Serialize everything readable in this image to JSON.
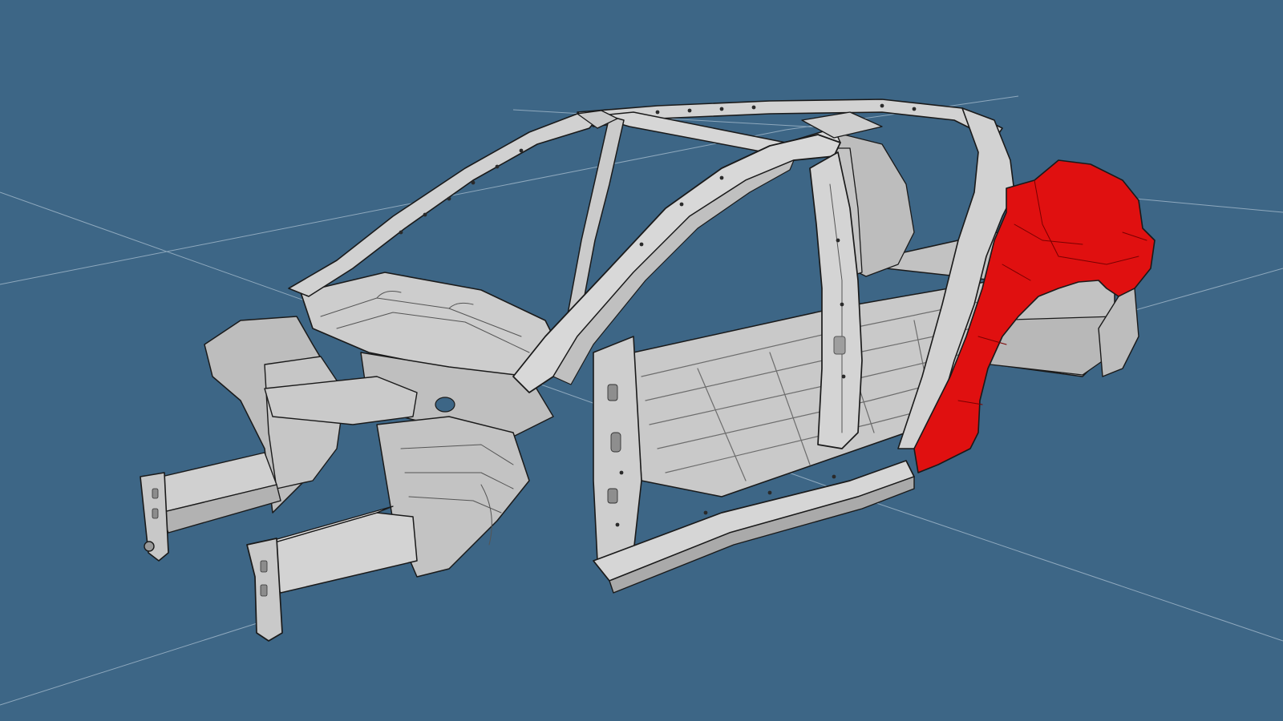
{
  "viewport": {
    "background_color": "#3d6686",
    "grid_line_color": "#9fb7c9"
  },
  "model": {
    "body_color": "#cfcfcf",
    "body_shadow_color": "#a9a9a9",
    "edge_color": "#1a1a1a",
    "highlight_color": "#e01010",
    "highlighted_part": "rear-quarter-panel"
  }
}
